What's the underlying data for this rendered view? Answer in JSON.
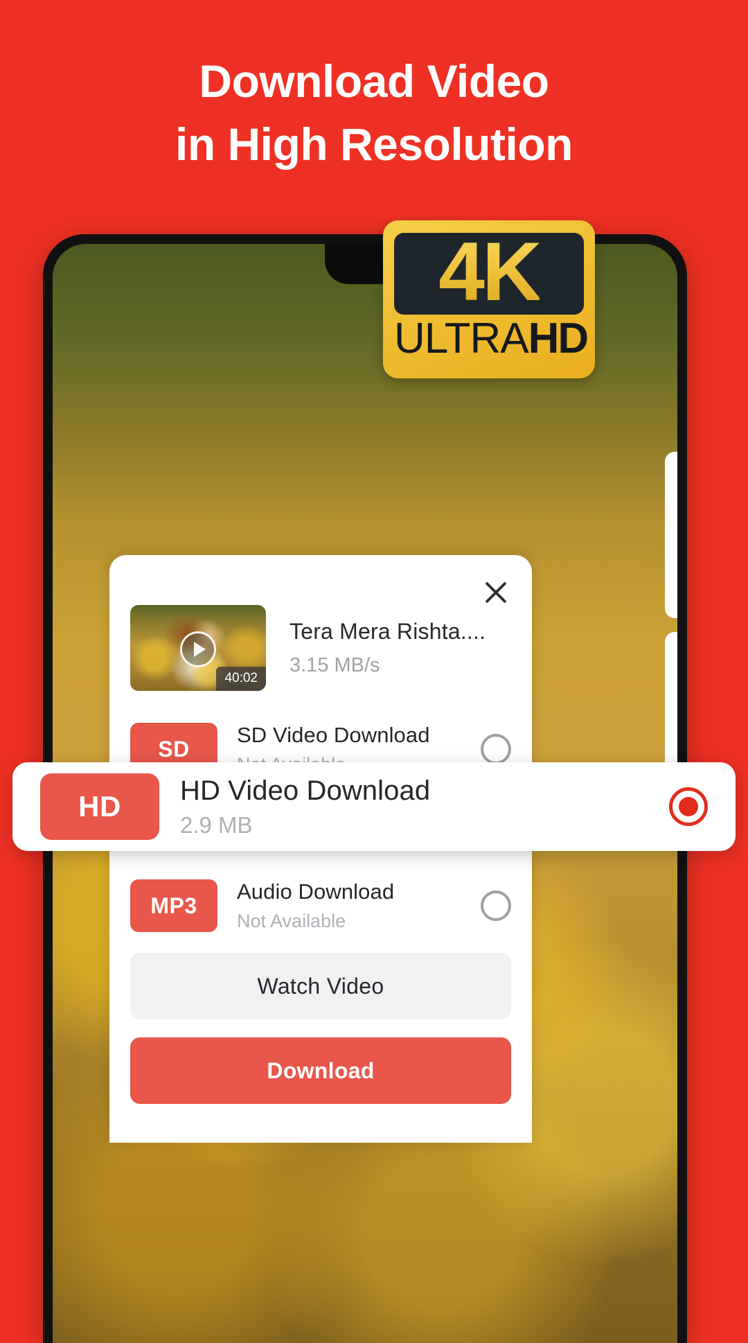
{
  "theme": {
    "background": "#EE3124",
    "accent": "#E8574A",
    "selected_radio": "#E22D1C",
    "badge_gold": "#F0BF32",
    "badge_dark": "#1F262B"
  },
  "headline": {
    "line1": "Download Video",
    "line2": "in High Resolution"
  },
  "badge": {
    "resolution": "4K",
    "ultra_label": "ULTRA",
    "hd_label": "HD"
  },
  "dialog": {
    "close_icon": "close-icon",
    "video": {
      "title": "Tera Mera Rishta....",
      "speed": "3.15 MB/s",
      "duration": "40:02",
      "play_icon": "play-icon"
    },
    "options": [
      {
        "tag": "SD",
        "title": "SD Video Download",
        "subtitle": "Not Available",
        "selected": false
      },
      {
        "tag": "MP3",
        "title": "Audio Download",
        "subtitle": "Not Available",
        "selected": false
      }
    ],
    "highlighted_option": {
      "tag": "HD",
      "title": "HD Video Download",
      "subtitle": "2.9 MB",
      "selected": true
    },
    "buttons": {
      "watch": "Watch Video",
      "download": "Download"
    }
  }
}
